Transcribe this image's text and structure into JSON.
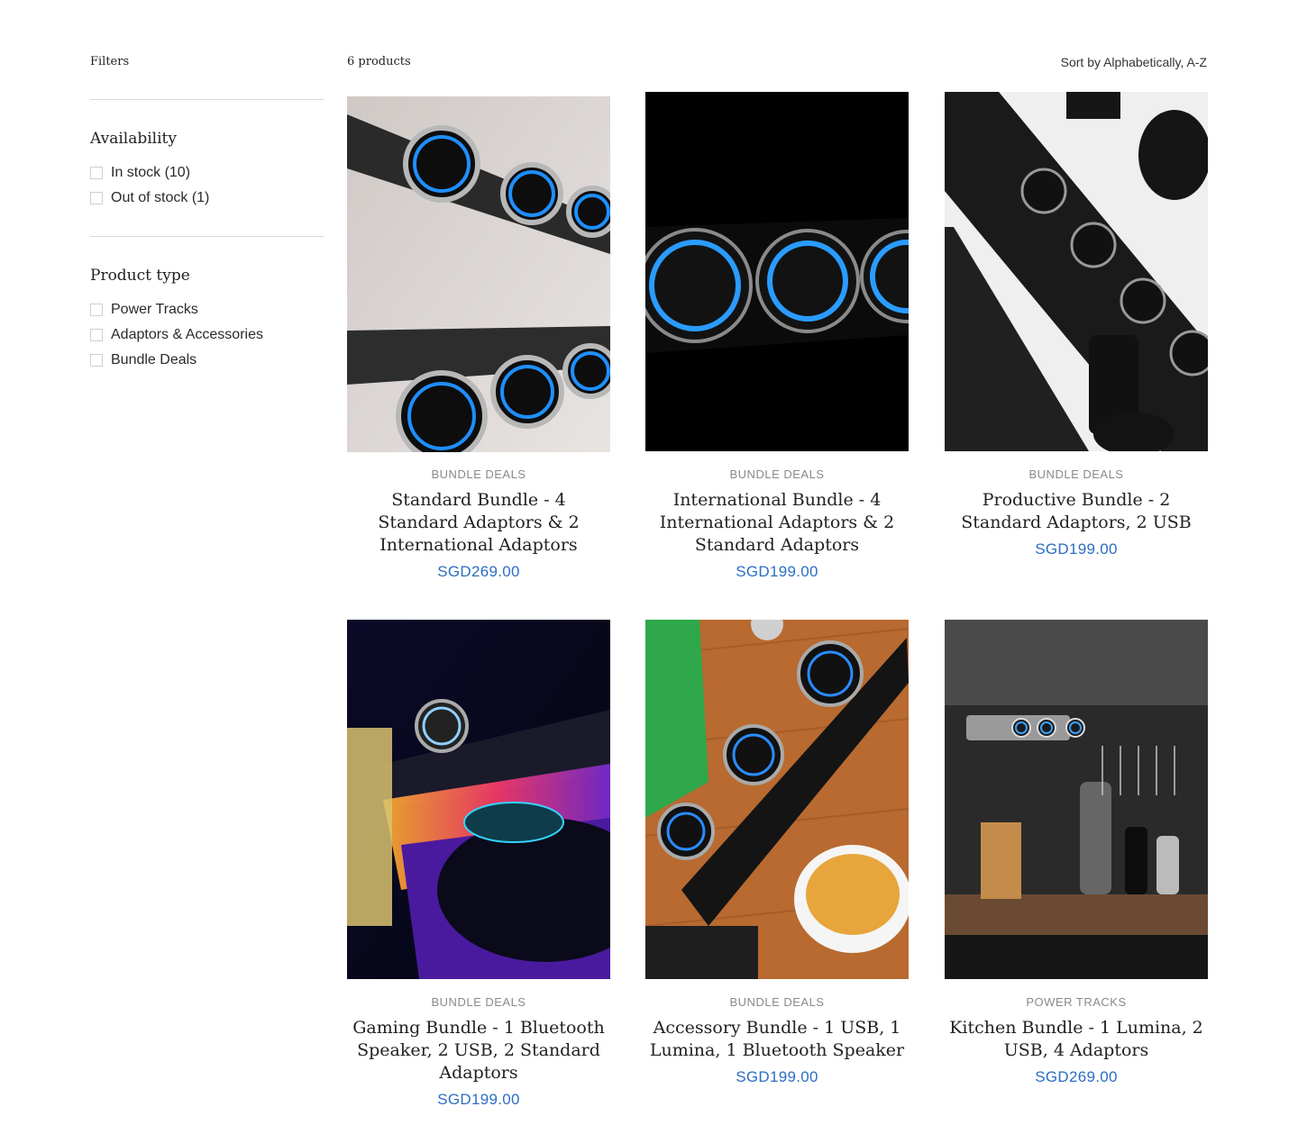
{
  "filters": {
    "label": "Filters",
    "availability": {
      "title": "Availability",
      "options": [
        "In stock (10)",
        "Out of stock (1)"
      ]
    },
    "product_type": {
      "title": "Product type",
      "options": [
        "Power Tracks",
        "Adaptors & Accessories",
        "Bundle Deals"
      ]
    }
  },
  "toolbar": {
    "count": "6 products",
    "sort": "Sort by Alphabetically, A-Z"
  },
  "products": [
    {
      "vendor": "BUNDLE DEALS",
      "title": "Standard Bundle - 4 Standard Adaptors & 2 International Adaptors",
      "price": "SGD269.00"
    },
    {
      "vendor": "BUNDLE DEALS",
      "title": "International Bundle - 4 International Adaptors & 2 Standard Adaptors",
      "price": "SGD199.00"
    },
    {
      "vendor": "BUNDLE DEALS",
      "title": "Productive Bundle - 2 Standard Adaptors, 2 USB",
      "price": "SGD199.00"
    },
    {
      "vendor": "BUNDLE DEALS",
      "title": "Gaming Bundle - 1 Bluetooth Speaker, 2 USB, 2 Standard Adaptors",
      "price": "SGD199.00"
    },
    {
      "vendor": "BUNDLE DEALS",
      "title": "Accessory Bundle - 1 USB, 1 Lumina, 1 Bluetooth Speaker",
      "price": "SGD199.00"
    },
    {
      "vendor": "POWER TRACKS",
      "title": "Kitchen Bundle - 1 Lumina, 2 USB, 4 Adaptors",
      "price": "SGD269.00"
    }
  ],
  "colors": {
    "price": "#2c6ec2",
    "vendor": "#8a8a8a",
    "divider": "#d9d9d9"
  }
}
